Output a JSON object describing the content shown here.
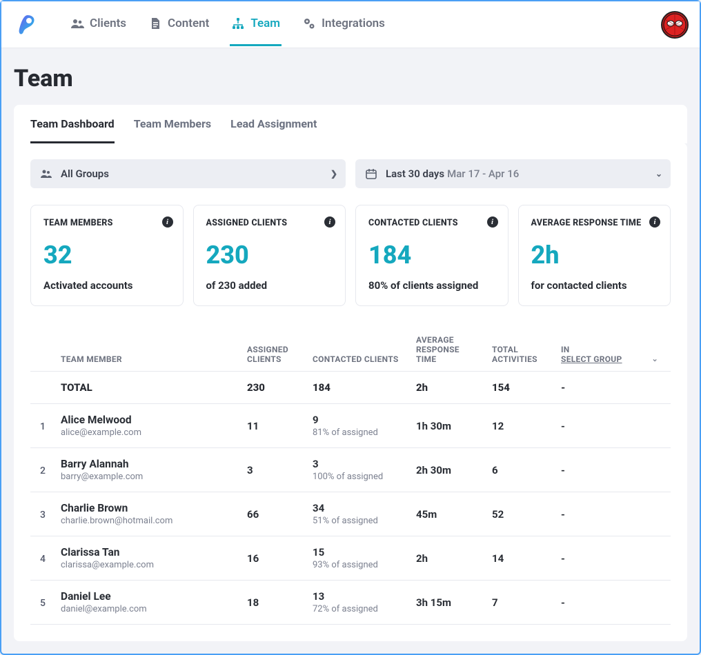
{
  "nav": {
    "clients": "Clients",
    "content": "Content",
    "team": "Team",
    "integrations": "Integrations"
  },
  "page": {
    "title": "Team"
  },
  "tabs": {
    "dashboard": "Team Dashboard",
    "members": "Team Members",
    "lead": "Lead Assignment"
  },
  "filters": {
    "group_label": "All Groups",
    "date_label": "Last 30 days",
    "date_range": "Mar 17 - Apr 16"
  },
  "stats": {
    "team_members": {
      "label": "TEAM MEMBERS",
      "value": "32",
      "sub": "Activated accounts"
    },
    "assigned": {
      "label": "ASSIGNED CLIENTS",
      "value": "230",
      "sub": "of 230 added"
    },
    "contacted": {
      "label": "CONTACTED CLIENTS",
      "value": "184",
      "sub": "80% of clients assigned"
    },
    "response": {
      "label": "AVERAGE RESPONSE TIME",
      "value": "2h",
      "sub": "for contacted clients"
    }
  },
  "table": {
    "headers": {
      "member": "TEAM MEMBER",
      "assigned": "ASSIGNED CLIENTS",
      "contacted": "CONTACTED CLIENTS",
      "response": "AVERAGE RESPONSE TIME",
      "activities": "TOTAL ACTIVITIES",
      "group_prefix": "IN",
      "group_select": "SELECT GROUP"
    },
    "total": {
      "label": "TOTAL",
      "assigned": "230",
      "contacted": "184",
      "response": "2h",
      "activities": "154",
      "group": "-"
    },
    "rows": [
      {
        "idx": "1",
        "name": "Alice Melwood",
        "email": "alice@example.com",
        "assigned": "11",
        "contacted": "9",
        "contacted_pct": "81% of assigned",
        "response": "1h 30m",
        "activities": "12",
        "group": "-"
      },
      {
        "idx": "2",
        "name": "Barry Alannah",
        "email": "barry@example.com",
        "assigned": "3",
        "contacted": "3",
        "contacted_pct": "100% of assigned",
        "response": "2h 30m",
        "activities": "6",
        "group": "-"
      },
      {
        "idx": "3",
        "name": "Charlie Brown",
        "email": "charlie.brown@hotmail.com",
        "assigned": "66",
        "contacted": "34",
        "contacted_pct": "51% of assigned",
        "response": "45m",
        "activities": "52",
        "group": "-"
      },
      {
        "idx": "4",
        "name": "Clarissa Tan",
        "email": "clarissa@example.com",
        "assigned": "16",
        "contacted": "15",
        "contacted_pct": "93% of assigned",
        "response": "2h",
        "activities": "14",
        "group": "-"
      },
      {
        "idx": "5",
        "name": "Daniel Lee",
        "email": "daniel@example.com",
        "assigned": "18",
        "contacted": "13",
        "contacted_pct": "72% of assigned",
        "response": "3h 15m",
        "activities": "7",
        "group": "-"
      }
    ]
  }
}
